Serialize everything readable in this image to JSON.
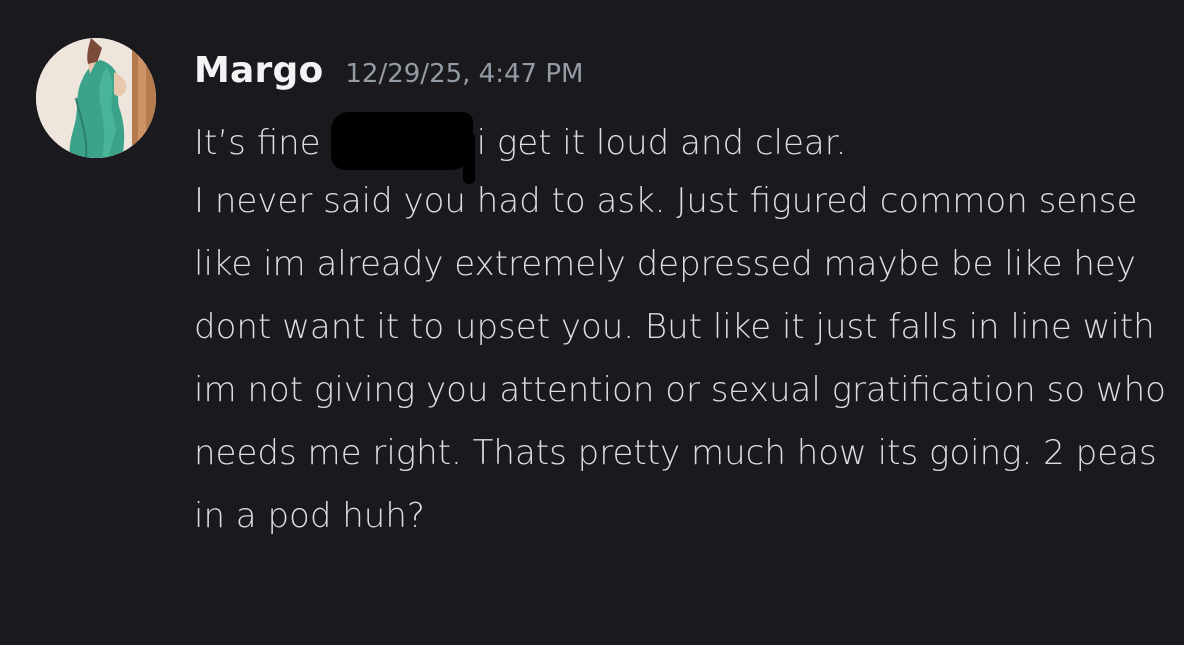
{
  "message": {
    "author": "Margo",
    "timestamp": "12/29/25, 4:47 PM",
    "line1_before": "It’s fine",
    "line1_after": "i get it loud and clear.",
    "body": "I never said you had to ask. Just figured common sense like im already extremely depressed maybe be like hey dont want it to upset you. But like it just falls in line with im not giving you attention or sexual gratification so who needs me right. Thats pretty much how its going. 2 peas in a pod huh?"
  },
  "colors": {
    "background": "#1a1a1e",
    "author": "#f2f3f5",
    "timestamp": "#949ba4",
    "text": "#dbdee1",
    "avatar_dress": "#3aa38a"
  },
  "icons": {
    "avatar": "profile-photo",
    "redaction": "scribble-redaction"
  }
}
